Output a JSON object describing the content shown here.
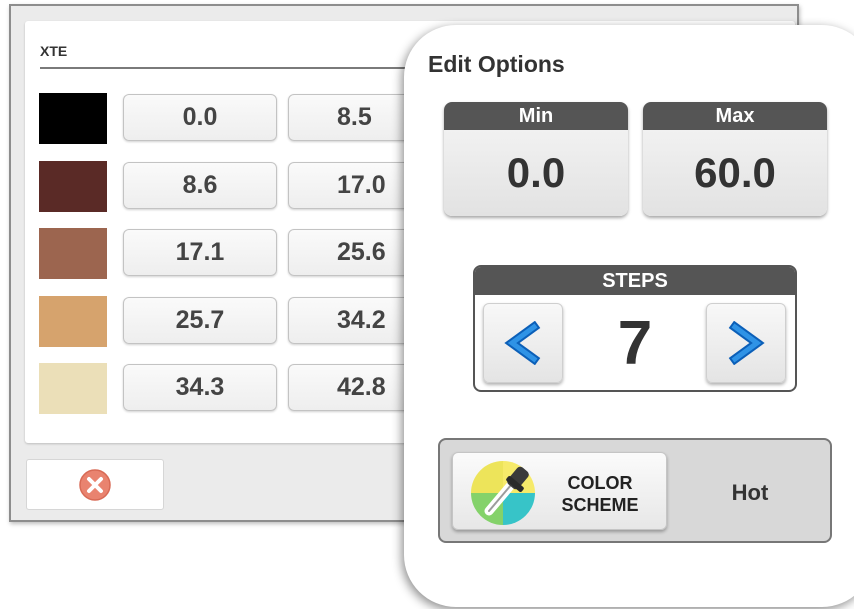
{
  "panel": {
    "title": "XTE",
    "colors": [
      "#000000",
      "#5a2a26",
      "#9c654f",
      "#d6a36d",
      "#ebdfb8"
    ],
    "ranges": [
      {
        "min": "0.0",
        "max": "8.5"
      },
      {
        "min": "8.6",
        "max": "17.0"
      },
      {
        "min": "17.1",
        "max": "25.6"
      },
      {
        "min": "25.7",
        "max": "34.2"
      },
      {
        "min": "34.3",
        "max": "42.8"
      }
    ],
    "close_icon": "close-x-icon"
  },
  "edit_options": {
    "title": "Edit Options",
    "min_label": "Min",
    "min_value": "0.0",
    "max_label": "Max",
    "max_value": "60.0",
    "steps_label": "STEPS",
    "steps_value": "7",
    "decrement_icon": "chevron-left-icon",
    "increment_icon": "chevron-right-icon",
    "color_scheme_label_line1": "COLOR",
    "color_scheme_label_line2": "SCHEME",
    "color_scheme_icon": "color-picker-icon",
    "color_scheme_value": "Hot"
  },
  "colors": {
    "header_dark": "#555555",
    "arrow_blue": "#1f7fd6",
    "close_red": "#e9836f"
  }
}
